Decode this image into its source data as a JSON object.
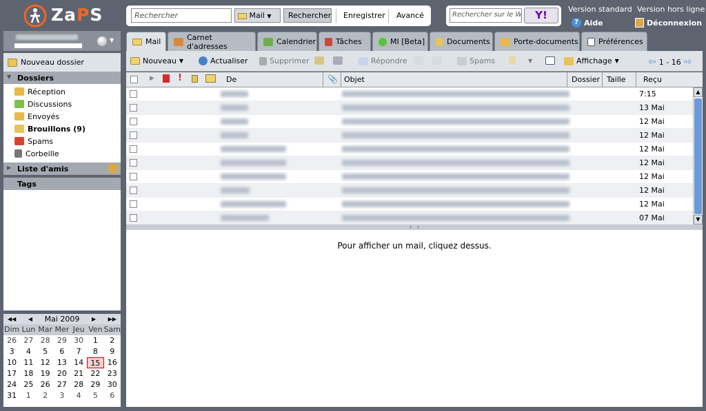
{
  "app": {
    "logo": "ZaPS"
  },
  "search": {
    "placeholder": "Rechercher",
    "scope": "Mail",
    "search_btn": "Rechercher",
    "save": "Enregistrer",
    "advanced": "Avancé"
  },
  "yahoo": {
    "placeholder": "Rechercher sur le W",
    "btn": "Y!"
  },
  "top_links": {
    "standard": "Version standard",
    "help": "Aide",
    "offline": "Version hors ligne",
    "logout": "Déconnexion"
  },
  "sidebar": {
    "new_folder": "Nouveau dossier",
    "folders_head": "Dossiers",
    "folders": [
      {
        "label": "Réception",
        "color": "#e8b84a"
      },
      {
        "label": "Discussions",
        "color": "#7cc24a"
      },
      {
        "label": "Envoyés",
        "color": "#e8b84a"
      },
      {
        "label": "Brouillons (9)",
        "color": "#e8c45a"
      },
      {
        "label": "Spams",
        "color": "#d9442f"
      },
      {
        "label": "Corbeille",
        "color": "#777"
      }
    ],
    "friends_head": "Liste d'amis",
    "tags_head": "Tags"
  },
  "calendar": {
    "month": "Mai 2009",
    "day_names": [
      "Dim",
      "Lun",
      "Mar",
      "Mer",
      "Jeu",
      "Ven",
      "Sam"
    ],
    "weeks": [
      [
        "26",
        "27",
        "28",
        "29",
        "30",
        "1",
        "2"
      ],
      [
        "3",
        "4",
        "5",
        "6",
        "7",
        "8",
        "9"
      ],
      [
        "10",
        "11",
        "12",
        "13",
        "14",
        "15",
        "16"
      ],
      [
        "17",
        "18",
        "19",
        "20",
        "21",
        "22",
        "23"
      ],
      [
        "24",
        "25",
        "26",
        "27",
        "28",
        "29",
        "30"
      ],
      [
        "31",
        "1",
        "2",
        "3",
        "4",
        "5",
        "6"
      ]
    ]
  },
  "tabs": [
    "Mail",
    "Carnet d'adresses",
    "Calendrier",
    "Tâches",
    "MI [Beta]",
    "Documents",
    "Porte-documents",
    "Préférences"
  ],
  "toolbar": {
    "new": "Nouveau",
    "refresh": "Actualiser",
    "delete": "Supprimer",
    "reply": "Répondre",
    "spam": "Spams",
    "view": "Affichage",
    "pager": "1 - 16"
  },
  "columns": {
    "from": "De",
    "subject": "Objet",
    "folder": "Dossier",
    "size": "Taille",
    "received": "Reçu"
  },
  "messages": [
    {
      "date": "7:15"
    },
    {
      "date": "13 Mai"
    },
    {
      "date": "12 Mai"
    },
    {
      "date": "12 Mai"
    },
    {
      "date": "12 Mai"
    },
    {
      "date": "12 Mai"
    },
    {
      "date": "12 Mai"
    },
    {
      "date": "12 Mai"
    },
    {
      "date": "12 Mai"
    },
    {
      "date": "07 Mai"
    }
  ],
  "preview": {
    "hint": "Pour afficher un mail, cliquez dessus."
  }
}
